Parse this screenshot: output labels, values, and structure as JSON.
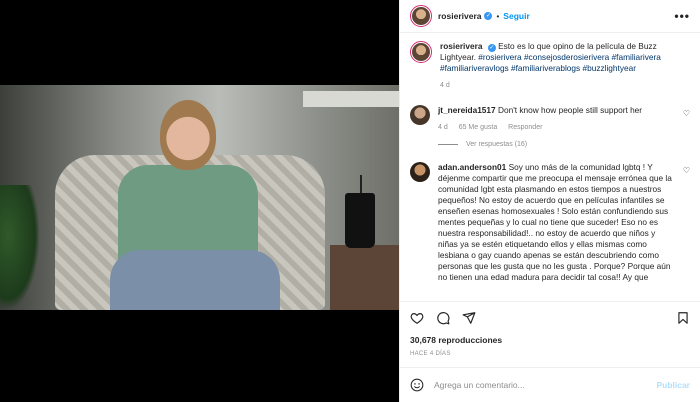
{
  "header": {
    "username": "rosierivera",
    "separator": "•",
    "follow_label": "Seguir",
    "more_label": "•••"
  },
  "caption": {
    "username": "rosierivera",
    "text": "Esto es lo que opino de la película de Buzz Lightyear.",
    "hashtags": "#rosierivera #consejosderosierivera #familiarivera #familiariveravlogs #familiariverablogs #buzzlightyear",
    "time": "4 d"
  },
  "comments": [
    {
      "username": "jt_nereida1517",
      "text": "Don't know how people still support her",
      "time": "4 d",
      "likes": "65 Me gusta",
      "reply_label": "Responder",
      "view_replies": "Ver respuestas (16)"
    },
    {
      "username": "adan.anderson01",
      "text": "Soy uno más de la comunidad lgbtq ! Y déjenme compartir que me preocupa el mensaje errónea que la comunidad lgbt esta plasmando en estos tiempos a nuestros pequeños! No estoy de acuerdo que en películas infantiles se enseñen esenas homosexuales ! Solo están confundiendo sus mentes pequeñas y lo cual no tiene que suceder! Eso no es nuestra responsabilidad!.. no estoy de acuerdo que niños y niñas ya se estén etiquetando ellos y ellas mismas como lesbiana o gay cuando apenas se están descubriendo como personas que les gusta que no les gusta . Porque? Porque aún no tienen una edad madura para decidir tal cosa!! Ay que"
    }
  ],
  "actions": {
    "views": "30,678 reproducciones",
    "posted_ago": "HACE 4 DÍAS",
    "icons": [
      "heart-icon",
      "comment-icon",
      "share-icon",
      "bookmark-icon"
    ]
  },
  "add_comment": {
    "placeholder": "Agrega un comentario...",
    "publish_label": "Publicar"
  },
  "colors": {
    "link_blue": "#0095f6",
    "hashtag": "#00376b",
    "verified": "#3897f0",
    "muted": "#8e8e8e"
  }
}
